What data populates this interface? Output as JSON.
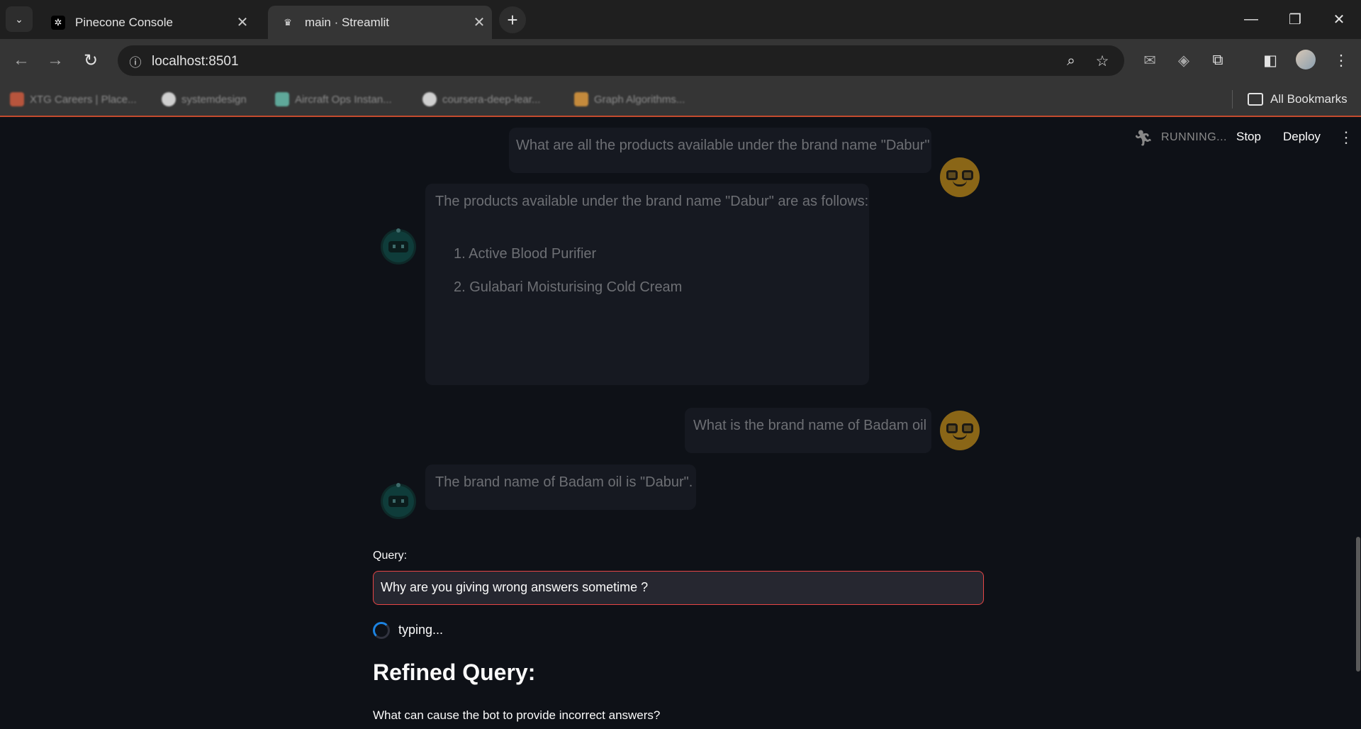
{
  "tabs": [
    {
      "title": "Pinecone Console",
      "favicon": "pinecone-icon"
    },
    {
      "title": "main · Streamlit",
      "favicon": "streamlit-crown-icon"
    }
  ],
  "address": {
    "url": "localhost:8501"
  },
  "bookmarks": [
    {
      "label": "XTG Careers | Place..."
    },
    {
      "label": "systemdesign"
    },
    {
      "label": "Aircraft Ops Instan..."
    },
    {
      "label": "coursera-deep-lear..."
    },
    {
      "label": "Graph Algorithms..."
    }
  ],
  "all_bookmarks_label": "All Bookmarks",
  "status": {
    "running": "RUNNING...",
    "stop": "Stop",
    "deploy": "Deploy"
  },
  "chat": {
    "m1": "What are all the products available under the brand name \"Dabur\"",
    "m2_intro": "The products available under the brand name \"Dabur\" are as follows:",
    "m2_items": [
      "1. Active Blood Purifier",
      "2. Gulabari Moisturising Cold Cream"
    ],
    "m3": "What is the brand name of Badam oil",
    "m4": "The brand name of Badam oil is \"Dabur\"."
  },
  "query": {
    "label": "Query:",
    "value": "Why are you giving wrong answers sometime ?"
  },
  "typing": "typing...",
  "refined": {
    "heading": "Refined Query:",
    "text": "What can cause the bot to provide incorrect answers?"
  },
  "colors": {
    "accent_red": "#e64545",
    "bg": "#0e1117",
    "spinner_blue": "#1c83e1",
    "user_avatar": "#8a6617"
  }
}
